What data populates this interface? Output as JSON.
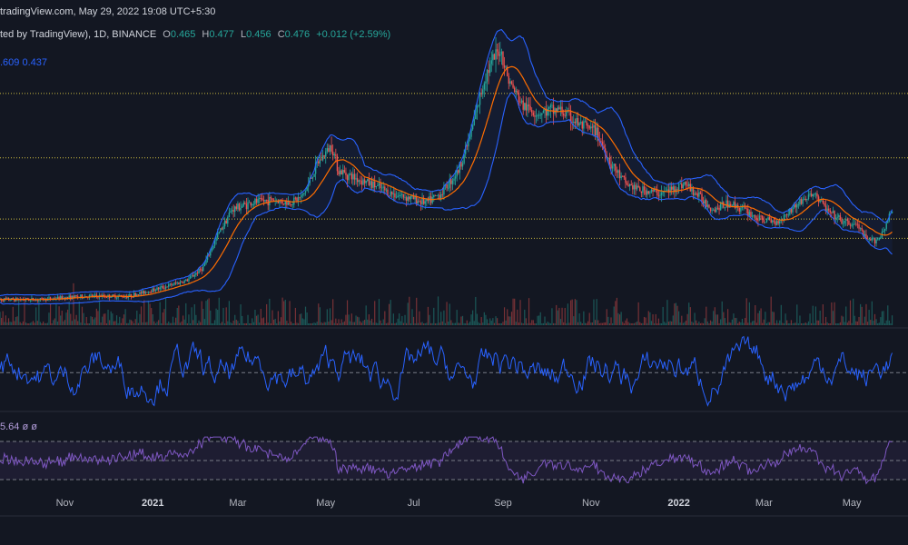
{
  "header": {
    "watermark": "tradingView.com, May 29, 2022 19:08 UTC+5:30",
    "symbol_line": "ted by TradingView), 1D, BINANCE",
    "o_label": "O",
    "o_value": "0.465",
    "h_label": "H",
    "h_value": "0.477",
    "l_label": "L",
    "l_value": "0.456",
    "c_label": "C",
    "c_value": "0.476",
    "change": "+0.012 (+2.59%)",
    "bb_values": ".609  0.437",
    "rsi_values": "5.64  ø  ø"
  },
  "colors": {
    "background": "#131722",
    "bb_band": "#2962ff",
    "bb_fill": "#2962ff",
    "basis": "#ff6d00",
    "up": "#26a69a",
    "down": "#ef5350",
    "osc": "#2962ff",
    "rsi": "#7e57c2",
    "hline": "#c9b93f"
  },
  "chart_data": {
    "type": "line",
    "title": "",
    "x_labels": [
      "Nov",
      "2021",
      "Mar",
      "May",
      "Jul",
      "Sep",
      "Nov",
      "2022",
      "Mar",
      "May"
    ],
    "x_label_is_year": [
      false,
      true,
      false,
      false,
      false,
      false,
      false,
      true,
      false,
      false
    ],
    "x_dates": [
      "2020-11-01",
      "2021-01-01",
      "2021-03-01",
      "2021-05-01",
      "2021-07-01",
      "2021-09-01",
      "2021-11-01",
      "2022-01-01",
      "2022-03-01",
      "2022-05-01"
    ],
    "price_series": {
      "name": "Close",
      "x": [
        "2020-09-15",
        "2020-10-15",
        "2020-11-15",
        "2020-12-15",
        "2021-01-10",
        "2021-01-25",
        "2021-02-05",
        "2021-02-15",
        "2021-02-25",
        "2021-03-10",
        "2021-03-25",
        "2021-04-05",
        "2021-04-15",
        "2021-04-25",
        "2021-05-05",
        "2021-05-10",
        "2021-05-20",
        "2021-06-01",
        "2021-06-15",
        "2021-06-25",
        "2021-07-10",
        "2021-07-20",
        "2021-08-01",
        "2021-08-10",
        "2021-08-20",
        "2021-08-30",
        "2021-09-05",
        "2021-09-15",
        "2021-09-25",
        "2021-10-10",
        "2021-10-25",
        "2021-11-05",
        "2021-11-15",
        "2021-11-25",
        "2021-12-05",
        "2021-12-20",
        "2022-01-05",
        "2022-01-15",
        "2022-01-25",
        "2022-02-05",
        "2022-02-15",
        "2022-02-25",
        "2022-03-10",
        "2022-03-25",
        "2022-04-05",
        "2022-04-15",
        "2022-04-25",
        "2022-05-05",
        "2022-05-12",
        "2022-05-20",
        "2022-05-29"
      ],
      "y": [
        0.2,
        0.2,
        0.21,
        0.21,
        0.24,
        0.26,
        0.3,
        0.4,
        0.48,
        0.5,
        0.51,
        0.5,
        0.52,
        0.62,
        0.68,
        0.6,
        0.58,
        0.56,
        0.53,
        0.52,
        0.5,
        0.53,
        0.6,
        0.72,
        0.9,
        0.98,
        0.88,
        0.8,
        0.78,
        0.79,
        0.74,
        0.72,
        0.62,
        0.56,
        0.54,
        0.53,
        0.56,
        0.52,
        0.48,
        0.5,
        0.48,
        0.45,
        0.44,
        0.5,
        0.53,
        0.47,
        0.44,
        0.43,
        0.38,
        0.39,
        0.476
      ]
    },
    "volume_series": {
      "name": "Volume"
    },
    "oscillator_series": {
      "name": ""
    },
    "rsi_series": {
      "name": ""
    },
    "horizontal_levels": [
      0.84,
      0.64,
      0.45,
      0.39
    ]
  }
}
